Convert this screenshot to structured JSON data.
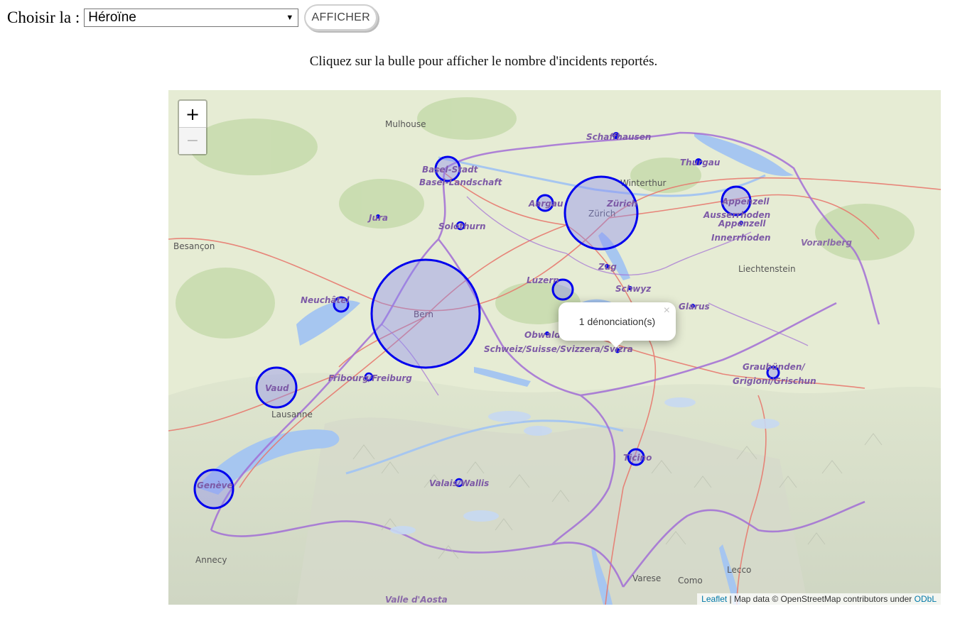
{
  "form": {
    "label": "Choisir la :",
    "select_value": "Héroïne",
    "button_label": "AFFICHER"
  },
  "hint": "Cliquez sur la bulle pour afficher le nombre d'incidents reportés.",
  "map": {
    "zoom_in": "+",
    "zoom_out": "−",
    "popup": {
      "text": "1 dénonciation(s)",
      "close": "×"
    },
    "attribution": {
      "leaflet": "Leaflet",
      "text": " | Map data © OpenStreetMap contributors under ",
      "odbl": "ODbL"
    },
    "colors": {
      "bubble_stroke": "#0000ee",
      "bubble_fill": "#8a8af2",
      "lake": "#a6c6f0",
      "border": "#a26ed6",
      "road": "#e8746a"
    },
    "cities": [
      "Mulhouse",
      "Besançon",
      "Winterthur",
      "Lausanne",
      "Zürich",
      "Liechtenstein",
      "Vorarlberg",
      "Annecy",
      "Varese",
      "Como",
      "Lecco",
      "Valle d'Aosta"
    ],
    "bubble_labels": {
      "basel": "Basel-Stadt",
      "basel_land": "Basel-Landschaft",
      "jura": "Jura",
      "solothurn": "Solothurn",
      "aargau": "Aargau",
      "schaffhausen": "Schaffhausen",
      "zurich": "Zürich",
      "thurgau": "Thurgau",
      "appenzell": "Appenzell",
      "appenzell_ausser": "Ausserrhoden",
      "appenzell_inner1": "Appenzell",
      "appenzell_inner2": "Innerrhoden",
      "bern": "Bern",
      "neuchatel": "Neuchâtel",
      "luzern": "Luzern",
      "zug": "Zug",
      "schwyz": "Schwyz",
      "glarus": "Glarus",
      "obwalden": "Obwalden",
      "schweiz": "Schweiz/Suisse/Svizzera/Svizra",
      "fribourg": "Fribourg/Freiburg",
      "vaud": "Vaud",
      "graubunden1": "Graubünden/",
      "graubunden2": "Grigioni/Grischun",
      "ticino": "Ticino",
      "valais": "Valais/Wallis",
      "geneve": "Genève"
    }
  }
}
